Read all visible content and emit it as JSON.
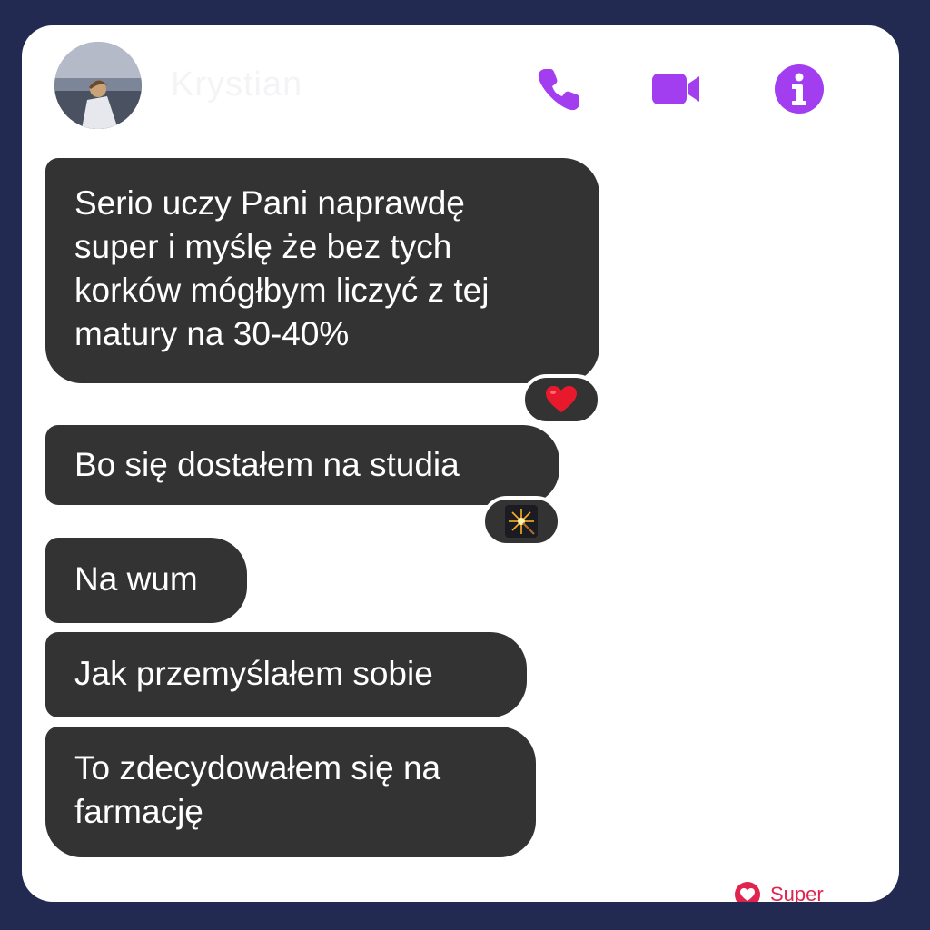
{
  "header": {
    "contact_name": "Krystian",
    "avatar": "profile-photo",
    "actions": [
      {
        "icon": "phone-icon",
        "color": "#a33df0"
      },
      {
        "icon": "video-camera-icon",
        "color": "#a33df0"
      },
      {
        "icon": "info-icon",
        "color": "#a33df0"
      }
    ]
  },
  "messages": [
    {
      "text": "Serio uczy Pani naprawdę\nsuper i myślę że bez tych\nkorków mógłbym liczyć z tej\nmatury na 30-40%",
      "reaction": "heart-emoji"
    },
    {
      "text": "Bo się dostałem na studia",
      "reaction": "sparkler-emoji"
    },
    {
      "text": "Na wum"
    },
    {
      "text": "Jak przemyślałem sobie"
    },
    {
      "text": "To zdecydowałem się na\nfarmację"
    }
  ],
  "badge": {
    "label": "Super",
    "icon": "heart-icon",
    "color": "#e0244e"
  },
  "colors": {
    "background": "#222a52",
    "card": "#ffffff",
    "bubble": "#333333",
    "accent": "#a33df0"
  }
}
